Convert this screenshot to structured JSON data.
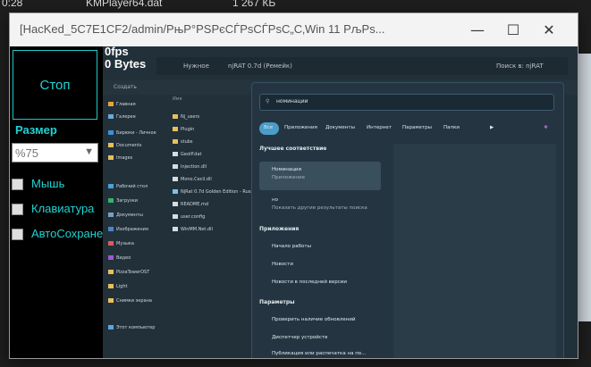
{
  "background": {
    "file_name": "KMPlayer64.dat",
    "file_size": "1 267 КБ",
    "left_time": "0:28"
  },
  "window": {
    "title": "[HacKed_5C7E1CF2/admin/РњР°РЅРєСЃРѕСЃРѕС„С‚Win 11 РљРѕ...",
    "minimize_icon": "minimize-icon",
    "maximize_icon": "maximize-icon",
    "close_icon": "close-icon"
  },
  "panel": {
    "stop_label": "Стоп",
    "size_label": "Размер",
    "size_value": "%75",
    "mouse_label": "Мышь",
    "keyboard_label": "Клавиатура",
    "autosave_label": "АвтоСохране"
  },
  "stream": {
    "fps": "0fps",
    "bytes": "0 Bytes"
  },
  "remote": {
    "explorer_breadcrumb_1": "Нужное",
    "explorer_breadcrumb_2": "njRAT 0.7d (Ремейк)",
    "explorer_search": "Поиск в: njRAT",
    "toolbar_create": "Создать",
    "col_name": "Имя",
    "nav_items": [
      "Главная",
      "Галерея",
      "Бирюки - Личное",
      "Documents",
      "Images",
      "Рабочий стол",
      "Загрузки",
      "Документы",
      "Изображения",
      "Музыка",
      "Видео",
      "PizzaTowerOST",
      "Light",
      "Снимки экрана",
      "Этот компьютер"
    ],
    "files": [
      "Nj_users",
      "Plugin",
      "stubs",
      "GeoIP.dat",
      "Injection.dll",
      "Mono.Cecil.dll",
      "NjRat 0.7d Golden Edition - Russian",
      "README.md",
      "user.config",
      "WinMM.Net.dll"
    ],
    "search_query": "номинации",
    "chips": [
      "Все",
      "Приложения",
      "Документы",
      "Интернет",
      "Параметры",
      "Папки"
    ],
    "best_header": "Лучшее соответствие",
    "best_title": "Номинации",
    "best_sub": "Приложение",
    "web_title": "но",
    "web_sub": "Показать другие результаты поиска",
    "apps_header": "Приложения",
    "apps": [
      "Начало работы",
      "Новости",
      "Новости в последней версии"
    ],
    "params_header": "Параметры",
    "params": [
      "Проверить наличие обновлений",
      "Диспетчер устройств",
      "Публикация или распечатка на по..."
    ]
  },
  "colors": {
    "accent": "#22d1d1",
    "panel_bg": "#000000",
    "titlebar_bg": "#f3f3f3"
  }
}
